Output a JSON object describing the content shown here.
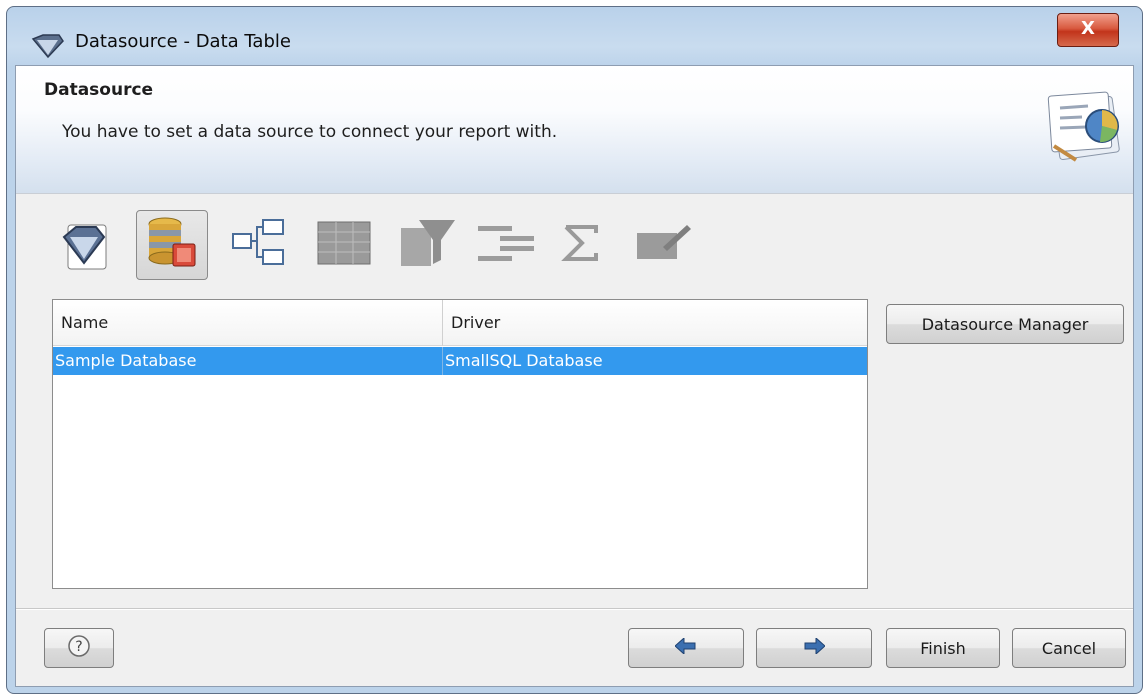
{
  "window": {
    "title": "Datasource - Data Table",
    "close_label": "X"
  },
  "header": {
    "title": "Datasource",
    "description": "You have to set a data source to connect your report with."
  },
  "steps": [
    {
      "icon": "report-diamond-icon",
      "active": false
    },
    {
      "icon": "database-icon",
      "active": true
    },
    {
      "icon": "hierarchy-icon",
      "active": false
    },
    {
      "icon": "table-grid-icon",
      "active": false
    },
    {
      "icon": "filter-funnel-icon",
      "active": false
    },
    {
      "icon": "align-lines-icon",
      "active": false
    },
    {
      "icon": "sigma-icon",
      "active": false
    },
    {
      "icon": "edit-box-icon",
      "active": false
    }
  ],
  "table": {
    "columns": [
      "Name",
      "Driver"
    ],
    "rows": [
      {
        "name": "Sample Database",
        "driver": "SmallSQL Database",
        "selected": true
      }
    ]
  },
  "buttons": {
    "datasource_manager": "Datasource Manager",
    "help": "?",
    "back": "back-arrow-icon",
    "next": "next-arrow-icon",
    "finish": "Finish",
    "cancel": "Cancel"
  },
  "colors": {
    "selection": "#3399ee",
    "titlebar": "#bcd3ea",
    "close": "#c2341b"
  }
}
